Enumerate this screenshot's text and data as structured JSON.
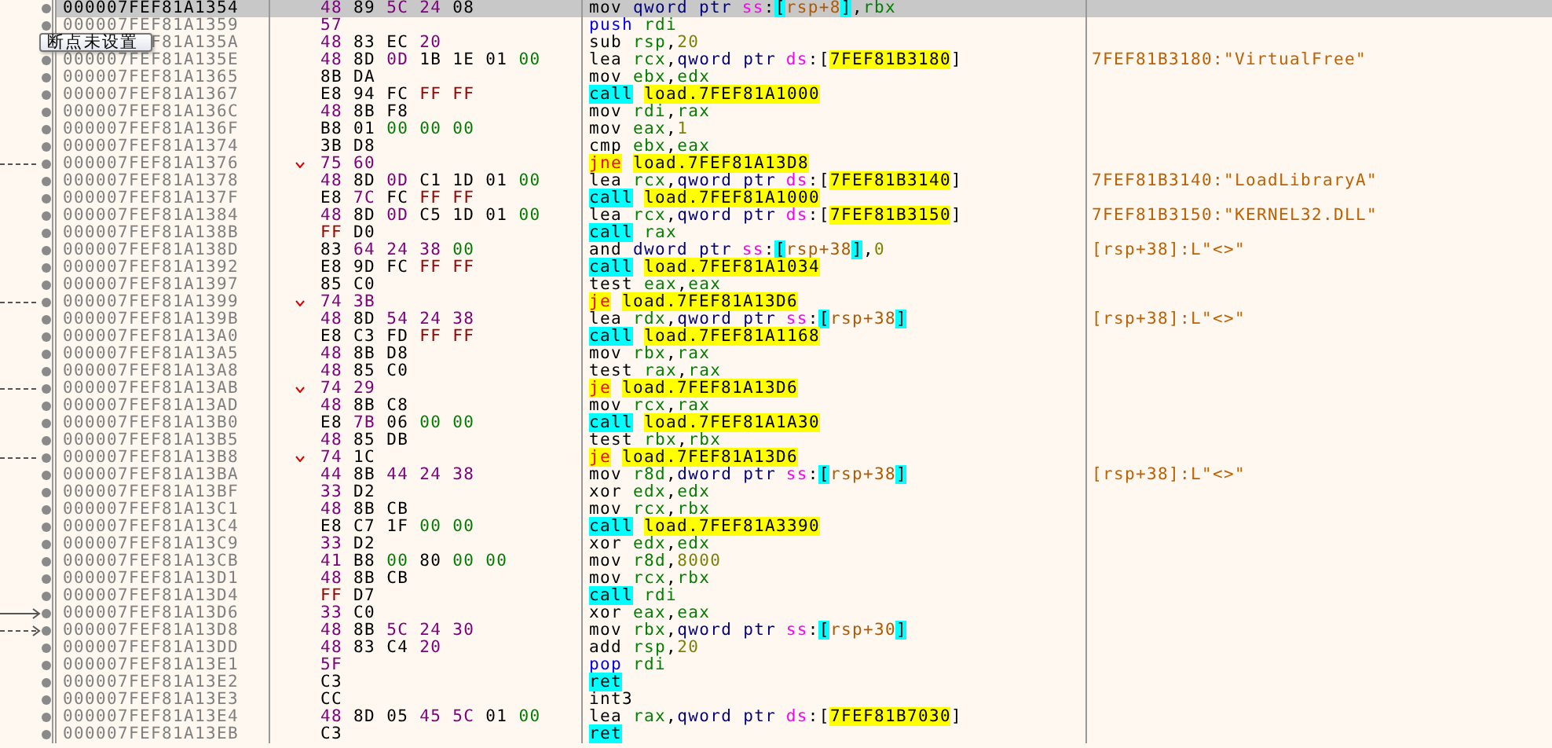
{
  "rows": [
    {
      "address": "000007FEF81A1354",
      "selected": true,
      "bytes": [
        {
          "text": "48",
          "kind": "ascii"
        },
        {
          "text": "89",
          "kind": "plain"
        },
        {
          "text": "5C",
          "kind": "ascii"
        },
        {
          "text": "24",
          "kind": "ascii"
        },
        {
          "text": "08",
          "kind": "plain"
        }
      ],
      "ops": [
        {
          "text": "mov",
          "kind": "mnemonic"
        },
        {
          "text": "qword ptr",
          "kind": "size"
        },
        {
          "text": "ss",
          "kind": "seg"
        },
        {
          "text": ":",
          "kind": "punct"
        },
        {
          "text": "[",
          "kind": "bracket"
        },
        {
          "text": "rsp+8",
          "kind": "memref"
        },
        {
          "text": "]",
          "kind": "bracket"
        },
        {
          "text": ",",
          "kind": "punct"
        },
        {
          "text": "rbx",
          "kind": "reg"
        }
      ]
    },
    {
      "address": "000007FEF81A1359",
      "selected": false,
      "bytes": [
        {
          "text": "57",
          "kind": "ascii"
        }
      ],
      "ops": [
        {
          "text": "push",
          "kind": "stack"
        },
        {
          "text": "rdi",
          "kind": "reg"
        }
      ]
    },
    {
      "address": "F81A135A",
      "selected": false,
      "tooltip": "断点未设置",
      "bytes": [
        {
          "text": "48",
          "kind": "ascii"
        },
        {
          "text": "83",
          "kind": "plain"
        },
        {
          "text": "EC",
          "kind": "plain"
        },
        {
          "text": "20",
          "kind": "ascii"
        }
      ],
      "ops": [
        {
          "text": "sub",
          "kind": "mnemonic"
        },
        {
          "text": "rsp",
          "kind": "reg"
        },
        {
          "text": ",",
          "kind": "punct"
        },
        {
          "text": "20",
          "kind": "imm"
        }
      ]
    },
    {
      "address": "000007FEF81A135E",
      "selected": false,
      "bytes": [
        {
          "text": "48",
          "kind": "ascii"
        },
        {
          "text": "8D",
          "kind": "plain"
        },
        {
          "text": "0D",
          "kind": "ascii"
        },
        {
          "text": "1B",
          "kind": "plain"
        },
        {
          "text": "1E",
          "kind": "plain"
        },
        {
          "text": "01",
          "kind": "plain"
        },
        {
          "text": "00",
          "kind": "zero"
        }
      ],
      "ops": [
        {
          "text": "lea",
          "kind": "mnemonic"
        },
        {
          "text": "rcx",
          "kind": "reg"
        },
        {
          "text": ",",
          "kind": "punct"
        },
        {
          "text": "qword ptr",
          "kind": "size"
        },
        {
          "text": "ds",
          "kind": "seg"
        },
        {
          "text": ":",
          "kind": "punct"
        },
        {
          "text": "[",
          "kind": "punct"
        },
        {
          "text": "7FEF81B3180",
          "kind": "addr"
        },
        {
          "text": "]",
          "kind": "punct"
        }
      ],
      "comment": "7FEF81B3180:\"VirtualFree\""
    },
    {
      "address": "000007FEF81A1365",
      "selected": false,
      "bytes": [
        {
          "text": "8B",
          "kind": "plain"
        },
        {
          "text": "DA",
          "kind": "plain"
        }
      ],
      "ops": [
        {
          "text": "mov",
          "kind": "mnemonic"
        },
        {
          "text": "ebx",
          "kind": "reg"
        },
        {
          "text": ",",
          "kind": "punct"
        },
        {
          "text": "edx",
          "kind": "reg"
        }
      ]
    },
    {
      "address": "000007FEF81A1367",
      "selected": false,
      "bytes": [
        {
          "text": "E8",
          "kind": "plain"
        },
        {
          "text": "94",
          "kind": "plain"
        },
        {
          "text": "FC",
          "kind": "plain"
        },
        {
          "text": "FF",
          "kind": "ff"
        },
        {
          "text": "FF",
          "kind": "ff"
        }
      ],
      "ops": [
        {
          "text": "call",
          "kind": "call"
        },
        {
          "text": "load.7FEF81A1000",
          "kind": "addr"
        }
      ]
    },
    {
      "address": "000007FEF81A136C",
      "selected": false,
      "bytes": [
        {
          "text": "48",
          "kind": "ascii"
        },
        {
          "text": "8B",
          "kind": "plain"
        },
        {
          "text": "F8",
          "kind": "plain"
        }
      ],
      "ops": [
        {
          "text": "mov",
          "kind": "mnemonic"
        },
        {
          "text": "rdi",
          "kind": "reg"
        },
        {
          "text": ",",
          "kind": "punct"
        },
        {
          "text": "rax",
          "kind": "reg"
        }
      ]
    },
    {
      "address": "000007FEF81A136F",
      "selected": false,
      "bytes": [
        {
          "text": "B8",
          "kind": "plain"
        },
        {
          "text": "01",
          "kind": "plain"
        },
        {
          "text": "00",
          "kind": "zero"
        },
        {
          "text": "00",
          "kind": "zero"
        },
        {
          "text": "00",
          "kind": "zero"
        }
      ],
      "ops": [
        {
          "text": "mov",
          "kind": "mnemonic"
        },
        {
          "text": "eax",
          "kind": "reg"
        },
        {
          "text": ",",
          "kind": "punct"
        },
        {
          "text": "1",
          "kind": "imm"
        }
      ]
    },
    {
      "address": "000007FEF81A1374",
      "selected": false,
      "bytes": [
        {
          "text": "3B",
          "kind": "plain"
        },
        {
          "text": "D8",
          "kind": "plain"
        }
      ],
      "ops": [
        {
          "text": "cmp",
          "kind": "mnemonic"
        },
        {
          "text": "ebx",
          "kind": "reg"
        },
        {
          "text": ",",
          "kind": "punct"
        },
        {
          "text": "eax",
          "kind": "reg"
        }
      ]
    },
    {
      "address": "000007FEF81A1376",
      "selected": false,
      "branch_out": true,
      "jump": true,
      "bytes": [
        {
          "text": "75",
          "kind": "ascii"
        },
        {
          "text": "60",
          "kind": "ascii"
        }
      ],
      "ops": [
        {
          "text": "jne",
          "kind": "jump"
        },
        {
          "text": "load.7FEF81A13D8",
          "kind": "addr"
        }
      ]
    },
    {
      "address": "000007FEF81A1378",
      "selected": false,
      "bytes": [
        {
          "text": "48",
          "kind": "ascii"
        },
        {
          "text": "8D",
          "kind": "plain"
        },
        {
          "text": "0D",
          "kind": "ascii"
        },
        {
          "text": "C1",
          "kind": "plain"
        },
        {
          "text": "1D",
          "kind": "plain"
        },
        {
          "text": "01",
          "kind": "plain"
        },
        {
          "text": "00",
          "kind": "zero"
        }
      ],
      "ops": [
        {
          "text": "lea",
          "kind": "mnemonic"
        },
        {
          "text": "rcx",
          "kind": "reg"
        },
        {
          "text": ",",
          "kind": "punct"
        },
        {
          "text": "qword ptr",
          "kind": "size"
        },
        {
          "text": "ds",
          "kind": "seg"
        },
        {
          "text": ":",
          "kind": "punct"
        },
        {
          "text": "[",
          "kind": "punct"
        },
        {
          "text": "7FEF81B3140",
          "kind": "addr"
        },
        {
          "text": "]",
          "kind": "punct"
        }
      ],
      "comment": "7FEF81B3140:\"LoadLibraryA\""
    },
    {
      "address": "000007FEF81A137F",
      "selected": false,
      "bytes": [
        {
          "text": "E8",
          "kind": "plain"
        },
        {
          "text": "7C",
          "kind": "ascii"
        },
        {
          "text": "FC",
          "kind": "plain"
        },
        {
          "text": "FF",
          "kind": "ff"
        },
        {
          "text": "FF",
          "kind": "ff"
        }
      ],
      "ops": [
        {
          "text": "call",
          "kind": "call"
        },
        {
          "text": "load.7FEF81A1000",
          "kind": "addr"
        }
      ]
    },
    {
      "address": "000007FEF81A1384",
      "selected": false,
      "bytes": [
        {
          "text": "48",
          "kind": "ascii"
        },
        {
          "text": "8D",
          "kind": "plain"
        },
        {
          "text": "0D",
          "kind": "ascii"
        },
        {
          "text": "C5",
          "kind": "plain"
        },
        {
          "text": "1D",
          "kind": "plain"
        },
        {
          "text": "01",
          "kind": "plain"
        },
        {
          "text": "00",
          "kind": "zero"
        }
      ],
      "ops": [
        {
          "text": "lea",
          "kind": "mnemonic"
        },
        {
          "text": "rcx",
          "kind": "reg"
        },
        {
          "text": ",",
          "kind": "punct"
        },
        {
          "text": "qword ptr",
          "kind": "size"
        },
        {
          "text": "ds",
          "kind": "seg"
        },
        {
          "text": ":",
          "kind": "punct"
        },
        {
          "text": "[",
          "kind": "punct"
        },
        {
          "text": "7FEF81B3150",
          "kind": "addr"
        },
        {
          "text": "]",
          "kind": "punct"
        }
      ],
      "comment": "7FEF81B3150:\"KERNEL32.DLL\""
    },
    {
      "address": "000007FEF81A138B",
      "selected": false,
      "bytes": [
        {
          "text": "FF",
          "kind": "ff"
        },
        {
          "text": "D0",
          "kind": "plain"
        }
      ],
      "ops": [
        {
          "text": "call",
          "kind": "call"
        },
        {
          "text": "rax",
          "kind": "reg"
        }
      ]
    },
    {
      "address": "000007FEF81A138D",
      "selected": false,
      "bytes": [
        {
          "text": "83",
          "kind": "plain"
        },
        {
          "text": "64",
          "kind": "ascii"
        },
        {
          "text": "24",
          "kind": "ascii"
        },
        {
          "text": "38",
          "kind": "ascii"
        },
        {
          "text": "00",
          "kind": "zero"
        }
      ],
      "ops": [
        {
          "text": "and",
          "kind": "mnemonic"
        },
        {
          "text": "dword ptr",
          "kind": "size"
        },
        {
          "text": "ss",
          "kind": "seg"
        },
        {
          "text": ":",
          "kind": "punct"
        },
        {
          "text": "[",
          "kind": "bracket"
        },
        {
          "text": "rsp+38",
          "kind": "memref"
        },
        {
          "text": "]",
          "kind": "bracket"
        },
        {
          "text": ",",
          "kind": "punct"
        },
        {
          "text": "0",
          "kind": "imm"
        }
      ],
      "comment": "[rsp+38]:L\"<>\""
    },
    {
      "address": "000007FEF81A1392",
      "selected": false,
      "bytes": [
        {
          "text": "E8",
          "kind": "plain"
        },
        {
          "text": "9D",
          "kind": "plain"
        },
        {
          "text": "FC",
          "kind": "plain"
        },
        {
          "text": "FF",
          "kind": "ff"
        },
        {
          "text": "FF",
          "kind": "ff"
        }
      ],
      "ops": [
        {
          "text": "call",
          "kind": "call"
        },
        {
          "text": "load.7FEF81A1034",
          "kind": "addr"
        }
      ]
    },
    {
      "address": "000007FEF81A1397",
      "selected": false,
      "bytes": [
        {
          "text": "85",
          "kind": "plain"
        },
        {
          "text": "C0",
          "kind": "plain"
        }
      ],
      "ops": [
        {
          "text": "test",
          "kind": "mnemonic"
        },
        {
          "text": "eax",
          "kind": "reg"
        },
        {
          "text": ",",
          "kind": "punct"
        },
        {
          "text": "eax",
          "kind": "reg"
        }
      ]
    },
    {
      "address": "000007FEF81A1399",
      "selected": false,
      "branch_out": true,
      "jump": true,
      "bytes": [
        {
          "text": "74",
          "kind": "ascii"
        },
        {
          "text": "3B",
          "kind": "ascii"
        }
      ],
      "ops": [
        {
          "text": "je",
          "kind": "jump"
        },
        {
          "text": "load.7FEF81A13D6",
          "kind": "addr"
        }
      ]
    },
    {
      "address": "000007FEF81A139B",
      "selected": false,
      "bytes": [
        {
          "text": "48",
          "kind": "ascii"
        },
        {
          "text": "8D",
          "kind": "plain"
        },
        {
          "text": "54",
          "kind": "ascii"
        },
        {
          "text": "24",
          "kind": "ascii"
        },
        {
          "text": "38",
          "kind": "ascii"
        }
      ],
      "ops": [
        {
          "text": "lea",
          "kind": "mnemonic"
        },
        {
          "text": "rdx",
          "kind": "reg"
        },
        {
          "text": ",",
          "kind": "punct"
        },
        {
          "text": "qword ptr",
          "kind": "size"
        },
        {
          "text": "ss",
          "kind": "seg"
        },
        {
          "text": ":",
          "kind": "punct"
        },
        {
          "text": "[",
          "kind": "bracket"
        },
        {
          "text": "rsp+38",
          "kind": "memref"
        },
        {
          "text": "]",
          "kind": "bracket"
        }
      ],
      "comment": "[rsp+38]:L\"<>\""
    },
    {
      "address": "000007FEF81A13A0",
      "selected": false,
      "bytes": [
        {
          "text": "E8",
          "kind": "plain"
        },
        {
          "text": "C3",
          "kind": "plain"
        },
        {
          "text": "FD",
          "kind": "plain"
        },
        {
          "text": "FF",
          "kind": "ff"
        },
        {
          "text": "FF",
          "kind": "ff"
        }
      ],
      "ops": [
        {
          "text": "call",
          "kind": "call"
        },
        {
          "text": "load.7FEF81A1168",
          "kind": "addr"
        }
      ]
    },
    {
      "address": "000007FEF81A13A5",
      "selected": false,
      "bytes": [
        {
          "text": "48",
          "kind": "ascii"
        },
        {
          "text": "8B",
          "kind": "plain"
        },
        {
          "text": "D8",
          "kind": "plain"
        }
      ],
      "ops": [
        {
          "text": "mov",
          "kind": "mnemonic"
        },
        {
          "text": "rbx",
          "kind": "reg"
        },
        {
          "text": ",",
          "kind": "punct"
        },
        {
          "text": "rax",
          "kind": "reg"
        }
      ]
    },
    {
      "address": "000007FEF81A13A8",
      "selected": false,
      "bytes": [
        {
          "text": "48",
          "kind": "ascii"
        },
        {
          "text": "85",
          "kind": "plain"
        },
        {
          "text": "C0",
          "kind": "plain"
        }
      ],
      "ops": [
        {
          "text": "test",
          "kind": "mnemonic"
        },
        {
          "text": "rax",
          "kind": "reg"
        },
        {
          "text": ",",
          "kind": "punct"
        },
        {
          "text": "rax",
          "kind": "reg"
        }
      ]
    },
    {
      "address": "000007FEF81A13AB",
      "selected": false,
      "branch_out": true,
      "jump": true,
      "bytes": [
        {
          "text": "74",
          "kind": "ascii"
        },
        {
          "text": "29",
          "kind": "ascii"
        }
      ],
      "ops": [
        {
          "text": "je",
          "kind": "jump"
        },
        {
          "text": "load.7FEF81A13D6",
          "kind": "addr"
        }
      ]
    },
    {
      "address": "000007FEF81A13AD",
      "selected": false,
      "bytes": [
        {
          "text": "48",
          "kind": "ascii"
        },
        {
          "text": "8B",
          "kind": "plain"
        },
        {
          "text": "C8",
          "kind": "plain"
        }
      ],
      "ops": [
        {
          "text": "mov",
          "kind": "mnemonic"
        },
        {
          "text": "rcx",
          "kind": "reg"
        },
        {
          "text": ",",
          "kind": "punct"
        },
        {
          "text": "rax",
          "kind": "reg"
        }
      ]
    },
    {
      "address": "000007FEF81A13B0",
      "selected": false,
      "bytes": [
        {
          "text": "E8",
          "kind": "plain"
        },
        {
          "text": "7B",
          "kind": "ascii"
        },
        {
          "text": "06",
          "kind": "plain"
        },
        {
          "text": "00",
          "kind": "zero"
        },
        {
          "text": "00",
          "kind": "zero"
        }
      ],
      "ops": [
        {
          "text": "call",
          "kind": "call"
        },
        {
          "text": "load.7FEF81A1A30",
          "kind": "addr"
        }
      ]
    },
    {
      "address": "000007FEF81A13B5",
      "selected": false,
      "bytes": [
        {
          "text": "48",
          "kind": "ascii"
        },
        {
          "text": "85",
          "kind": "plain"
        },
        {
          "text": "DB",
          "kind": "plain"
        }
      ],
      "ops": [
        {
          "text": "test",
          "kind": "mnemonic"
        },
        {
          "text": "rbx",
          "kind": "reg"
        },
        {
          "text": ",",
          "kind": "punct"
        },
        {
          "text": "rbx",
          "kind": "reg"
        }
      ]
    },
    {
      "address": "000007FEF81A13B8",
      "selected": false,
      "branch_out": true,
      "jump": true,
      "bytes": [
        {
          "text": "74",
          "kind": "ascii"
        },
        {
          "text": "1C",
          "kind": "plain"
        }
      ],
      "ops": [
        {
          "text": "je",
          "kind": "jump"
        },
        {
          "text": "load.7FEF81A13D6",
          "kind": "addr"
        }
      ]
    },
    {
      "address": "000007FEF81A13BA",
      "selected": false,
      "bytes": [
        {
          "text": "44",
          "kind": "ascii"
        },
        {
          "text": "8B",
          "kind": "plain"
        },
        {
          "text": "44",
          "kind": "ascii"
        },
        {
          "text": "24",
          "kind": "ascii"
        },
        {
          "text": "38",
          "kind": "ascii"
        }
      ],
      "ops": [
        {
          "text": "mov",
          "kind": "mnemonic"
        },
        {
          "text": "r8d",
          "kind": "reg"
        },
        {
          "text": ",",
          "kind": "punct"
        },
        {
          "text": "dword ptr",
          "kind": "size"
        },
        {
          "text": "ss",
          "kind": "seg"
        },
        {
          "text": ":",
          "kind": "punct"
        },
        {
          "text": "[",
          "kind": "bracket"
        },
        {
          "text": "rsp+38",
          "kind": "memref"
        },
        {
          "text": "]",
          "kind": "bracket"
        }
      ],
      "comment": "[rsp+38]:L\"<>\""
    },
    {
      "address": "000007FEF81A13BF",
      "selected": false,
      "bytes": [
        {
          "text": "33",
          "kind": "ascii"
        },
        {
          "text": "D2",
          "kind": "plain"
        }
      ],
      "ops": [
        {
          "text": "xor",
          "kind": "mnemonic"
        },
        {
          "text": "edx",
          "kind": "reg"
        },
        {
          "text": ",",
          "kind": "punct"
        },
        {
          "text": "edx",
          "kind": "reg"
        }
      ]
    },
    {
      "address": "000007FEF81A13C1",
      "selected": false,
      "bytes": [
        {
          "text": "48",
          "kind": "ascii"
        },
        {
          "text": "8B",
          "kind": "plain"
        },
        {
          "text": "CB",
          "kind": "plain"
        }
      ],
      "ops": [
        {
          "text": "mov",
          "kind": "mnemonic"
        },
        {
          "text": "rcx",
          "kind": "reg"
        },
        {
          "text": ",",
          "kind": "punct"
        },
        {
          "text": "rbx",
          "kind": "reg"
        }
      ]
    },
    {
      "address": "000007FEF81A13C4",
      "selected": false,
      "bytes": [
        {
          "text": "E8",
          "kind": "plain"
        },
        {
          "text": "C7",
          "kind": "plain"
        },
        {
          "text": "1F",
          "kind": "plain"
        },
        {
          "text": "00",
          "kind": "zero"
        },
        {
          "text": "00",
          "kind": "zero"
        }
      ],
      "ops": [
        {
          "text": "call",
          "kind": "call"
        },
        {
          "text": "load.7FEF81A3390",
          "kind": "addr"
        }
      ]
    },
    {
      "address": "000007FEF81A13C9",
      "selected": false,
      "bytes": [
        {
          "text": "33",
          "kind": "ascii"
        },
        {
          "text": "D2",
          "kind": "plain"
        }
      ],
      "ops": [
        {
          "text": "xor",
          "kind": "mnemonic"
        },
        {
          "text": "edx",
          "kind": "reg"
        },
        {
          "text": ",",
          "kind": "punct"
        },
        {
          "text": "edx",
          "kind": "reg"
        }
      ]
    },
    {
      "address": "000007FEF81A13CB",
      "selected": false,
      "bytes": [
        {
          "text": "41",
          "kind": "ascii"
        },
        {
          "text": "B8",
          "kind": "plain"
        },
        {
          "text": "00",
          "kind": "zero"
        },
        {
          "text": "80",
          "kind": "plain"
        },
        {
          "text": "00",
          "kind": "zero"
        },
        {
          "text": "00",
          "kind": "zero"
        }
      ],
      "ops": [
        {
          "text": "mov",
          "kind": "mnemonic"
        },
        {
          "text": "r8d",
          "kind": "reg"
        },
        {
          "text": ",",
          "kind": "punct"
        },
        {
          "text": "8000",
          "kind": "imm"
        }
      ]
    },
    {
      "address": "000007FEF81A13D1",
      "selected": false,
      "bytes": [
        {
          "text": "48",
          "kind": "ascii"
        },
        {
          "text": "8B",
          "kind": "plain"
        },
        {
          "text": "CB",
          "kind": "plain"
        }
      ],
      "ops": [
        {
          "text": "mov",
          "kind": "mnemonic"
        },
        {
          "text": "rcx",
          "kind": "reg"
        },
        {
          "text": ",",
          "kind": "punct"
        },
        {
          "text": "rbx",
          "kind": "reg"
        }
      ]
    },
    {
      "address": "000007FEF81A13D4",
      "selected": false,
      "bytes": [
        {
          "text": "FF",
          "kind": "ff"
        },
        {
          "text": "D7",
          "kind": "plain"
        }
      ],
      "ops": [
        {
          "text": "call",
          "kind": "call"
        },
        {
          "text": "rdi",
          "kind": "reg"
        }
      ]
    },
    {
      "address": "000007FEF81A13D6",
      "selected": false,
      "branch_in": true,
      "branch_dashed": false,
      "bytes": [
        {
          "text": "33",
          "kind": "ascii"
        },
        {
          "text": "C0",
          "kind": "plain"
        }
      ],
      "ops": [
        {
          "text": "xor",
          "kind": "mnemonic"
        },
        {
          "text": "eax",
          "kind": "reg"
        },
        {
          "text": ",",
          "kind": "punct"
        },
        {
          "text": "eax",
          "kind": "reg"
        }
      ]
    },
    {
      "address": "000007FEF81A13D8",
      "selected": false,
      "branch_in": true,
      "branch_dashed": true,
      "bytes": [
        {
          "text": "48",
          "kind": "ascii"
        },
        {
          "text": "8B",
          "kind": "plain"
        },
        {
          "text": "5C",
          "kind": "ascii"
        },
        {
          "text": "24",
          "kind": "ascii"
        },
        {
          "text": "30",
          "kind": "ascii"
        }
      ],
      "ops": [
        {
          "text": "mov",
          "kind": "mnemonic"
        },
        {
          "text": "rbx",
          "kind": "reg"
        },
        {
          "text": ",",
          "kind": "punct"
        },
        {
          "text": "qword ptr",
          "kind": "size"
        },
        {
          "text": "ss",
          "kind": "seg"
        },
        {
          "text": ":",
          "kind": "punct"
        },
        {
          "text": "[",
          "kind": "bracket"
        },
        {
          "text": "rsp+30",
          "kind": "memref"
        },
        {
          "text": "]",
          "kind": "bracket"
        }
      ]
    },
    {
      "address": "000007FEF81A13DD",
      "selected": false,
      "bytes": [
        {
          "text": "48",
          "kind": "ascii"
        },
        {
          "text": "83",
          "kind": "plain"
        },
        {
          "text": "C4",
          "kind": "plain"
        },
        {
          "text": "20",
          "kind": "ascii"
        }
      ],
      "ops": [
        {
          "text": "add",
          "kind": "mnemonic"
        },
        {
          "text": "rsp",
          "kind": "reg"
        },
        {
          "text": ",",
          "kind": "punct"
        },
        {
          "text": "20",
          "kind": "imm"
        }
      ]
    },
    {
      "address": "000007FEF81A13E1",
      "selected": false,
      "bytes": [
        {
          "text": "5F",
          "kind": "ascii"
        }
      ],
      "ops": [
        {
          "text": "pop",
          "kind": "stack"
        },
        {
          "text": "rdi",
          "kind": "reg"
        }
      ]
    },
    {
      "address": "000007FEF81A13E2",
      "selected": false,
      "bytes": [
        {
          "text": "C3",
          "kind": "plain"
        }
      ],
      "ops": [
        {
          "text": "ret",
          "kind": "call"
        }
      ]
    },
    {
      "address": "000007FEF81A13E3",
      "selected": false,
      "bytes": [
        {
          "text": "CC",
          "kind": "plain"
        }
      ],
      "ops": [
        {
          "text": "int3",
          "kind": "mnemonic"
        }
      ]
    },
    {
      "address": "000007FEF81A13E4",
      "selected": false,
      "bytes": [
        {
          "text": "48",
          "kind": "ascii"
        },
        {
          "text": "8D",
          "kind": "plain"
        },
        {
          "text": "05",
          "kind": "plain"
        },
        {
          "text": "45",
          "kind": "ascii"
        },
        {
          "text": "5C",
          "kind": "ascii"
        },
        {
          "text": "01",
          "kind": "plain"
        },
        {
          "text": "00",
          "kind": "zero"
        }
      ],
      "ops": [
        {
          "text": "lea",
          "kind": "mnemonic"
        },
        {
          "text": "rax",
          "kind": "reg"
        },
        {
          "text": ",",
          "kind": "punct"
        },
        {
          "text": "qword ptr",
          "kind": "size"
        },
        {
          "text": "ds",
          "kind": "seg"
        },
        {
          "text": ":",
          "kind": "punct"
        },
        {
          "text": "[",
          "kind": "punct"
        },
        {
          "text": "7FEF81B7030",
          "kind": "addr"
        },
        {
          "text": "]",
          "kind": "punct"
        }
      ]
    },
    {
      "address": "000007FEF81A13EB",
      "selected": false,
      "bytes": [
        {
          "text": "C3",
          "kind": "plain"
        }
      ],
      "ops": [
        {
          "text": "ret",
          "kind": "call"
        }
      ]
    }
  ]
}
